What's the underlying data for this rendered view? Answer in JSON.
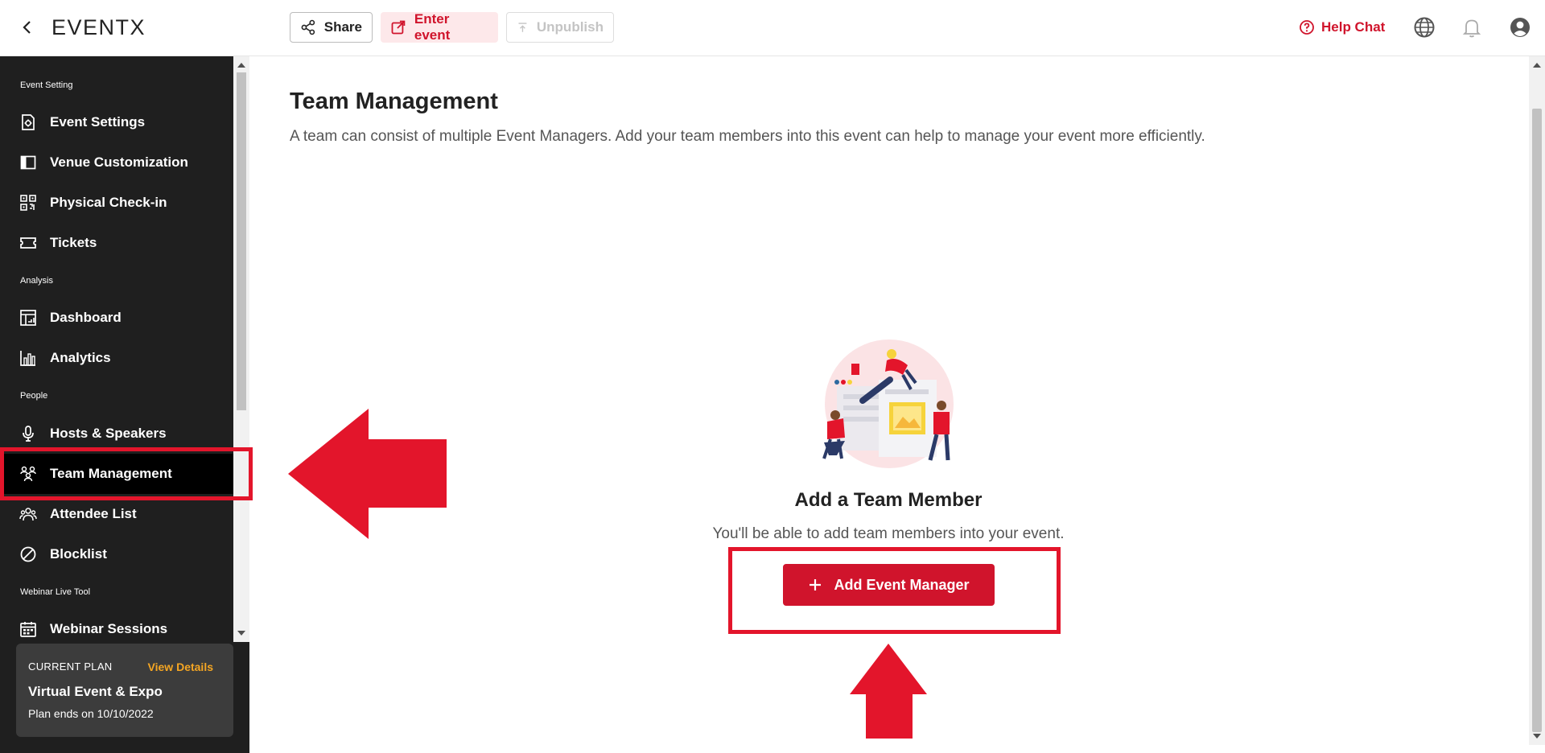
{
  "header": {
    "logo": "EVENTX",
    "share_label": "Share",
    "enter_label": "Enter event",
    "unpublish_label": "Unpublish",
    "help_label": "Help Chat",
    "icons": [
      "back-icon",
      "share-icon",
      "external-link-icon",
      "upload-icon",
      "help-icon",
      "globe-icon",
      "bell-icon",
      "account-icon"
    ]
  },
  "sidebar": {
    "sections": [
      {
        "label": "Event Setting",
        "items": [
          {
            "label": "Event Settings",
            "icon": "settings-doc-icon"
          },
          {
            "label": "Venue Customization",
            "icon": "layout-icon"
          },
          {
            "label": "Physical Check-in",
            "icon": "qr-code-icon"
          },
          {
            "label": "Tickets",
            "icon": "ticket-icon"
          }
        ]
      },
      {
        "label": "Analysis",
        "items": [
          {
            "label": "Dashboard",
            "icon": "dashboard-icon"
          },
          {
            "label": "Analytics",
            "icon": "bar-chart-icon"
          }
        ]
      },
      {
        "label": "People",
        "items": [
          {
            "label": "Hosts & Speakers",
            "icon": "microphone-icon"
          },
          {
            "label": "Team Management",
            "icon": "team-icon",
            "active": true
          },
          {
            "label": "Attendee List",
            "icon": "attendees-icon"
          },
          {
            "label": "Blocklist",
            "icon": "block-icon"
          }
        ]
      },
      {
        "label": "Webinar Live Tool",
        "items": [
          {
            "label": "Webinar Sessions",
            "icon": "calendar-icon"
          }
        ]
      }
    ]
  },
  "plan": {
    "caption": "CURRENT PLAN",
    "link": "View Details",
    "name": "Virtual Event & Expo",
    "ends": "Plan ends on 10/10/2022"
  },
  "main": {
    "title": "Team Management",
    "description": "A team can consist of multiple Event Managers. Add your team members into this event can help to manage your event more efficiently.",
    "empty_title": "Add a Team Member",
    "empty_subtitle": "You'll be able to add team members into your event.",
    "add_button": "Add Event Manager"
  },
  "colors": {
    "brand_red": "#d0142c",
    "sidebar_bg": "#1f1f1f",
    "plan_link": "#f5a623",
    "annotation_red": "#e3152b"
  }
}
